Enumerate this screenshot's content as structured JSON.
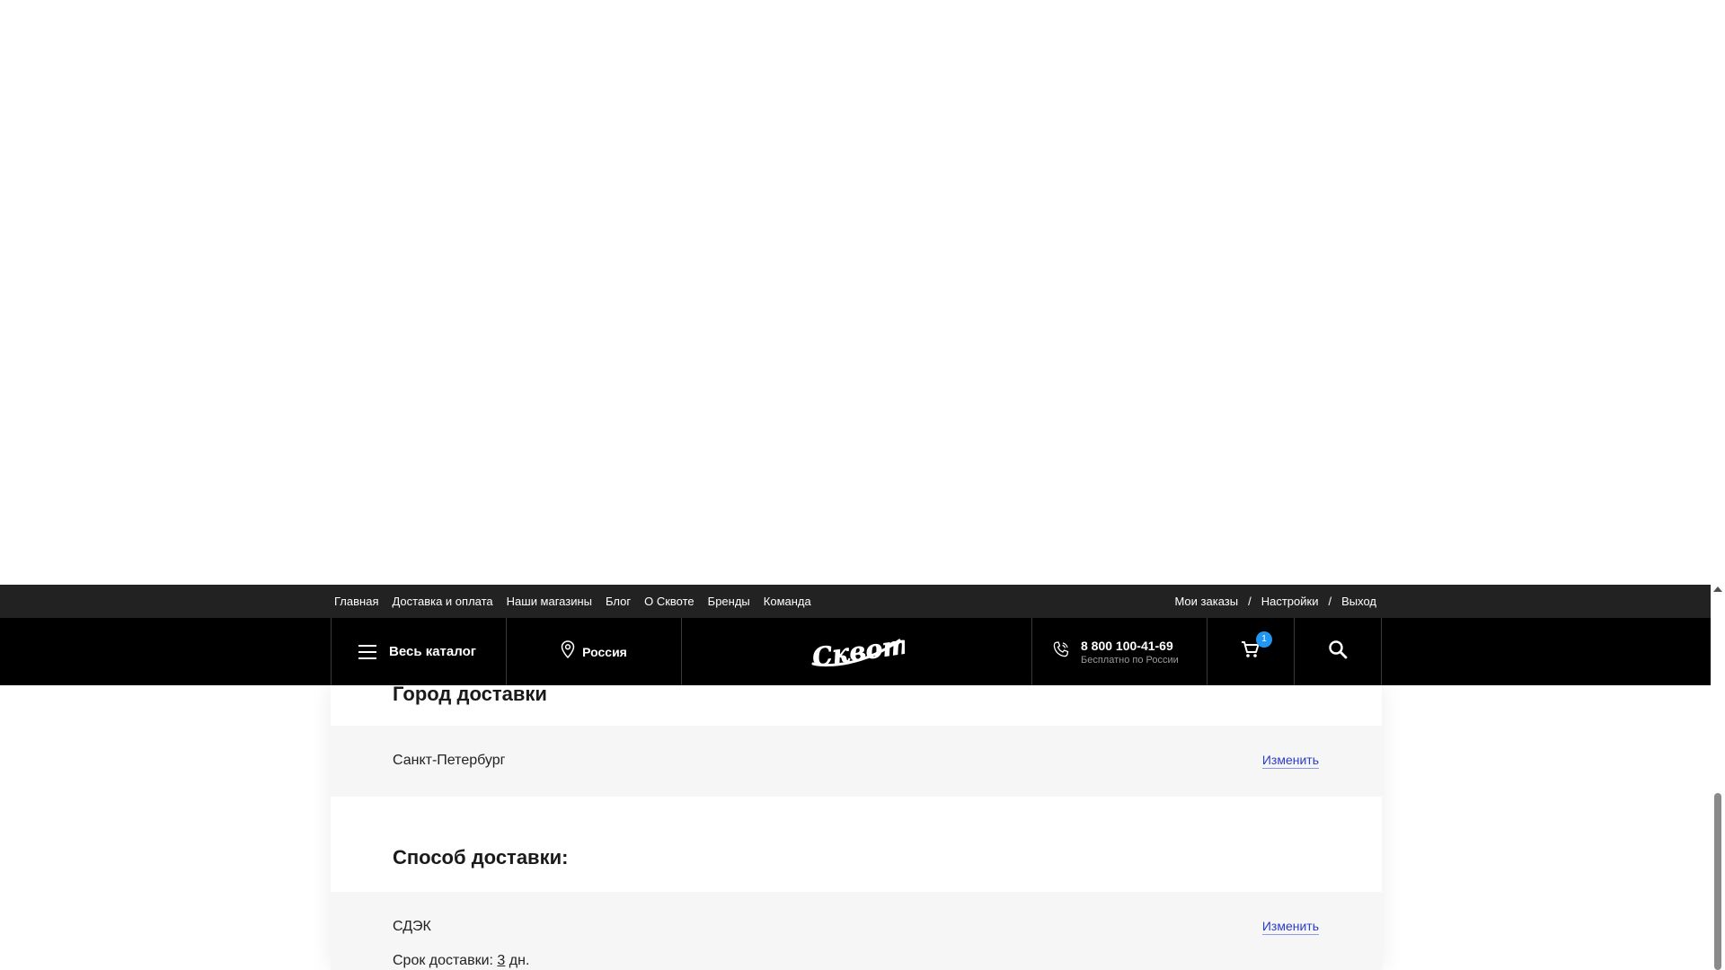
{
  "topnav": {
    "links": [
      "Главная",
      "Доставка и оплата",
      "Наши магазины",
      "Блог",
      "О Сквоте",
      "Бренды",
      "Команда"
    ],
    "user_links": [
      "Мои заказы",
      "Настройки",
      "Выход"
    ],
    "separator": "/"
  },
  "header": {
    "catalog_label": "Весь каталог",
    "region_label": "Россия",
    "logo_text": "Сквот",
    "phone_number": "8 800 100-41-69",
    "phone_note": "Бесплатно по России",
    "cart_count": "1"
  },
  "delivery": {
    "city_title": "Город доставки",
    "city_value": "Санкт-Петербург",
    "change_label": "Изменить",
    "method_title": "Способ доставки:",
    "method_value": "СДЭК",
    "term_prefix": "Срок доставки:",
    "term_days": "3",
    "term_suffix": "дн."
  },
  "colors": {
    "header_bg": "#000000",
    "topbar_bg": "#222222",
    "badge": "#2196f3",
    "link": "#2a3cc8",
    "row_bg": "#f6f6f6"
  }
}
